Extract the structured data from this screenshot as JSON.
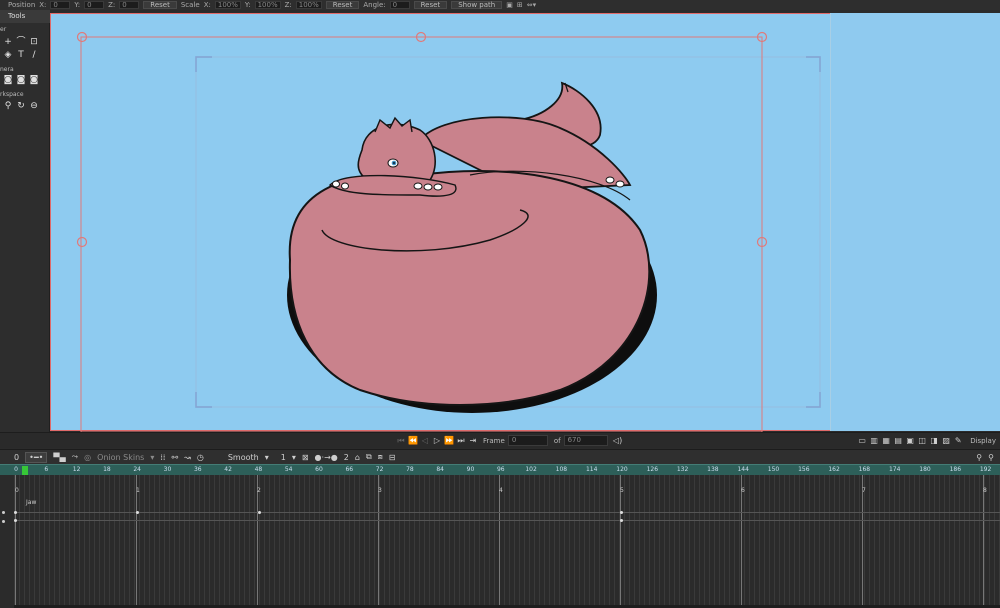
{
  "properties_bar": {
    "position_label": "Position",
    "x_label": "X:",
    "x_value": "0",
    "y_label": "Y:",
    "y_value": "0",
    "z_label": "Z:",
    "z_value": "0",
    "reset1": "Reset",
    "scale_label": "Scale",
    "sx_label": "X:",
    "sx_value": "100%",
    "sy_label": "Y:",
    "sy_value": "100%",
    "sz_label": "Z:",
    "sz_value": "100%",
    "reset2": "Reset",
    "angle_label": "Angle:",
    "angle_value": "0",
    "reset3": "Reset",
    "show_path": "Show path"
  },
  "tools_panel": {
    "tab_label": "Tools",
    "section_layer": "er",
    "section_camera": "nera",
    "section_workspace": "rkspace",
    "layer_tools_row1": [
      "+",
      "⌒",
      "⊡"
    ],
    "layer_tools_row2": [
      "◈",
      "T",
      "/"
    ],
    "camera_tools": [
      "◙",
      "◙",
      "◙"
    ],
    "workspace_tools": [
      "⚲",
      "↻",
      "⊖"
    ]
  },
  "playback": {
    "frame_label": "Frame",
    "frame_value": "0",
    "of_label": "of",
    "total_frames": "670",
    "display_label": "Display"
  },
  "timeline_toolbar": {
    "frame_zero": "0",
    "onion_skins": "Onion Skins",
    "interp_mode": "Smooth",
    "step_value": "1",
    "key_count": "2"
  },
  "ruler": {
    "ticks": [
      "0",
      "6",
      "12",
      "18",
      "24",
      "30",
      "36",
      "42",
      "48",
      "54",
      "60",
      "66",
      "72",
      "78",
      "84",
      "90",
      "96",
      "102",
      "108",
      "114",
      "120",
      "126",
      "132",
      "138",
      "144",
      "150",
      "156",
      "162",
      "168",
      "174",
      "180",
      "186",
      "192"
    ]
  },
  "tracks": {
    "layer_name": "Jaw",
    "second_labels": [
      "0",
      "1",
      "2",
      "3",
      "4",
      "5",
      "6",
      "7",
      "8"
    ]
  },
  "colors": {
    "canvas_bg": "#8ecbf0",
    "character_fill": "#c9828c",
    "character_outline": "#151515",
    "bounding_box": "#e06a6a",
    "ruler_bg": "#2d5f59",
    "playhead": "#37c737"
  }
}
